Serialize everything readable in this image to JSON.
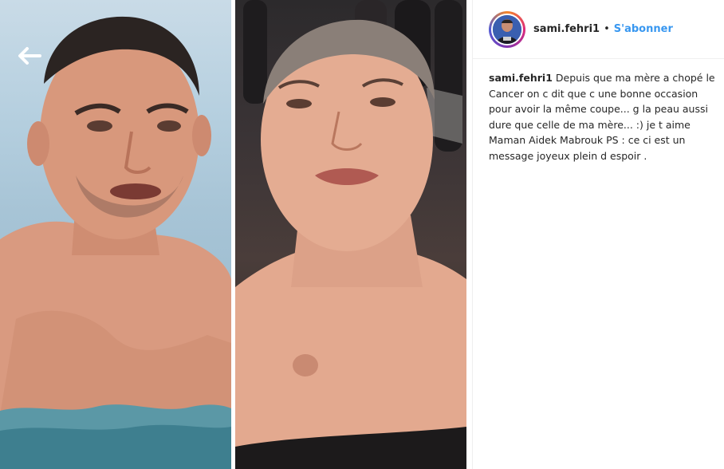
{
  "post": {
    "author": {
      "username": "sami.fehri1",
      "follow_label": "S'abonner",
      "separator": "•"
    },
    "caption": {
      "username": "sami.fehri1",
      "text": "Depuis que ma mère a chopé le Cancer on c dit que c une bonne occasion pour avoir la même coupe... g la peau aussi dure que celle de ma mère... :) je t aime Maman Aidek Mabrouk PS : ce ci est un message joyeux plein d espoir ."
    }
  },
  "icons": {
    "back": "arrow-left-icon"
  },
  "colors": {
    "accent": "#3897f0",
    "text": "#262626",
    "border": "#efefef"
  }
}
